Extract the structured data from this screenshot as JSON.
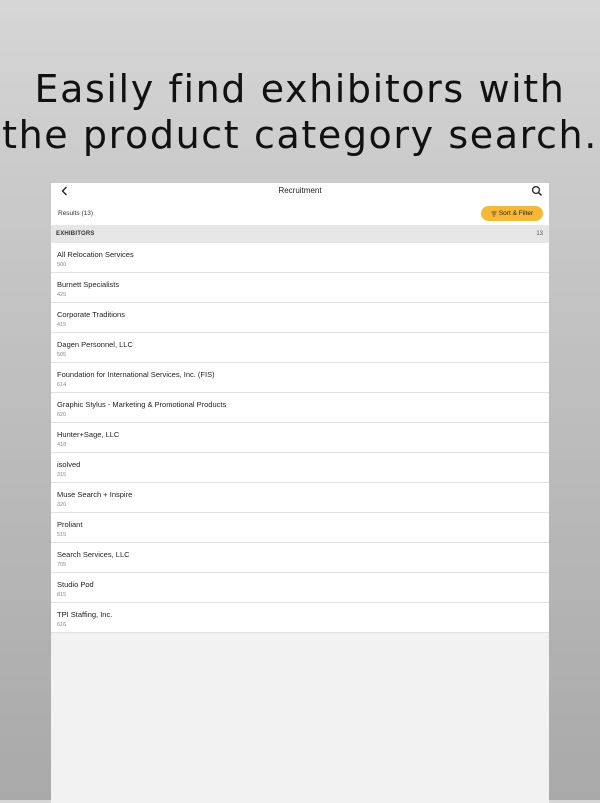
{
  "headline": {
    "line1": "Easily find exhibitors with",
    "line2": "the product category search."
  },
  "navbar": {
    "title": "Recruitment",
    "back_icon": "chevron-left-icon",
    "search_icon": "search-icon"
  },
  "results": {
    "label": "Results (13)",
    "sort_filter_label": "Sort & Filter",
    "accent_color": "#f6b937"
  },
  "section": {
    "title": "EXHIBITORS",
    "count": "13"
  },
  "exhibitors": [
    {
      "name": "All Relocation Services",
      "booth": "500"
    },
    {
      "name": "Burnett Specialists",
      "booth": "425"
    },
    {
      "name": "Corporate Traditions",
      "booth": "415"
    },
    {
      "name": "Dagen Personnel, LLC",
      "booth": "505"
    },
    {
      "name": "Foundation for International Services, Inc. (FIS)",
      "booth": "614"
    },
    {
      "name": "Graphic Stylus - Marketing & Promotional Products",
      "booth": "620"
    },
    {
      "name": "Hunter+Sage, LLC",
      "booth": "418"
    },
    {
      "name": "isolved",
      "booth": "315"
    },
    {
      "name": "Muse Search + Inspire",
      "booth": "320"
    },
    {
      "name": "Proliant",
      "booth": "515"
    },
    {
      "name": "Search Services, LLC",
      "booth": "705"
    },
    {
      "name": "Studio Pod",
      "booth": "815"
    },
    {
      "name": "TPI Staffing, Inc.",
      "booth": "616"
    }
  ]
}
